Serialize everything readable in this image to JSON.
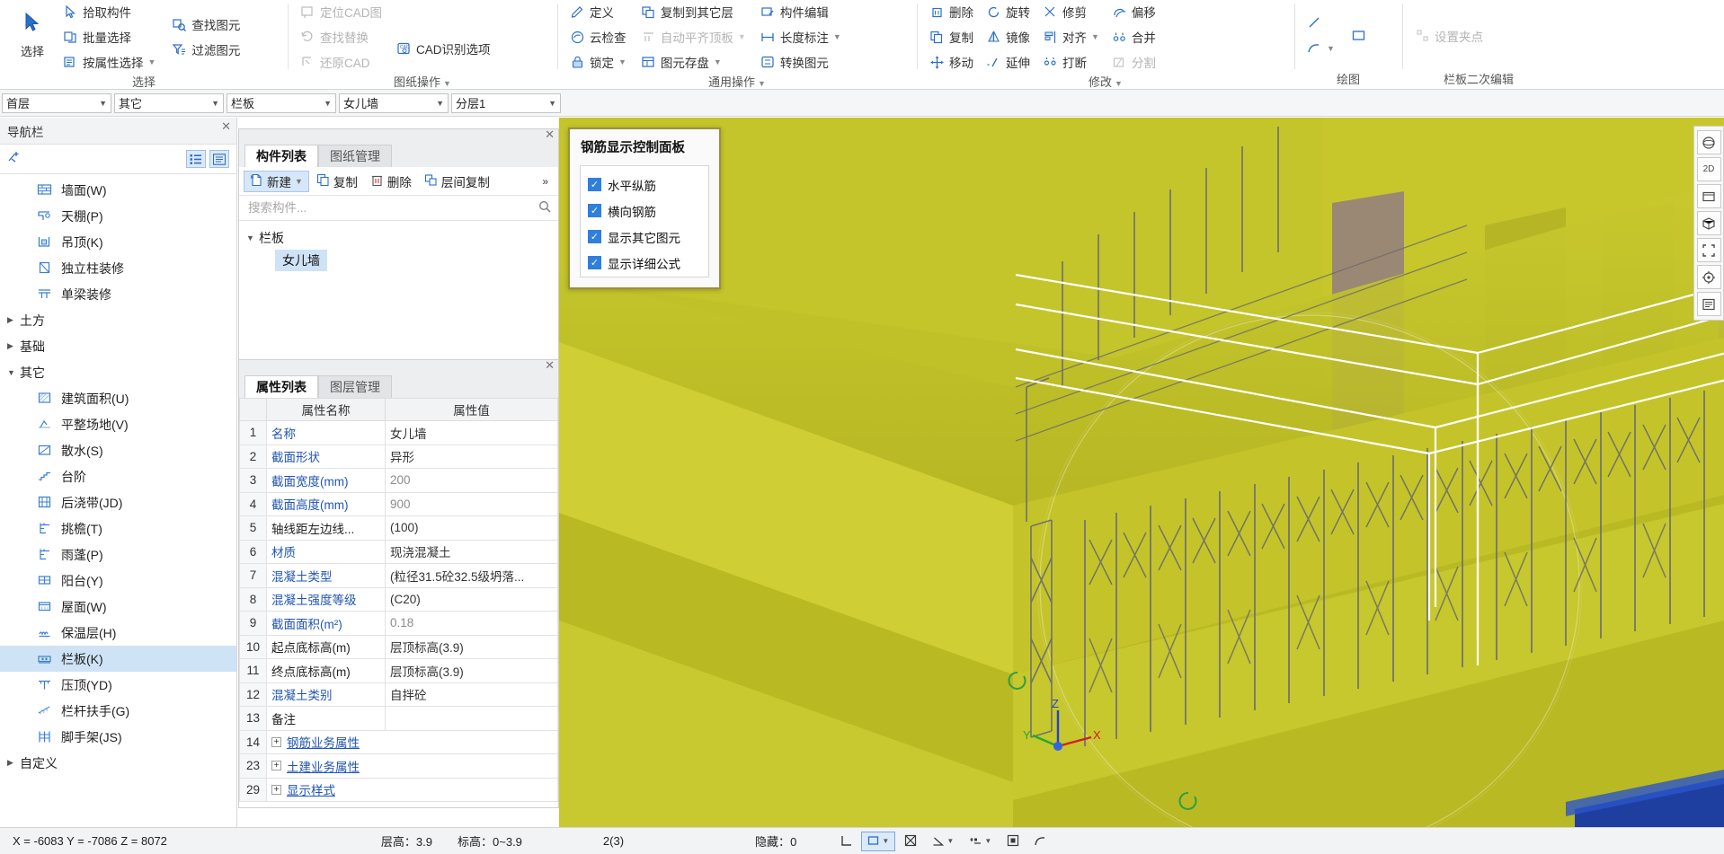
{
  "ribbon": {
    "groups": [
      {
        "title": "选择",
        "big": {
          "label": "选择",
          "icon": "cursor-arrow-icon"
        },
        "items": [
          {
            "label": "拾取构件",
            "icon": "pick-element-icon",
            "caret": false,
            "disabled": false
          },
          {
            "label": "批量选择",
            "icon": "batch-select-icon",
            "caret": false,
            "disabled": false
          },
          {
            "label": "按属性选择",
            "icon": "select-by-property-icon",
            "caret": true,
            "disabled": false
          }
        ],
        "items2": [
          {
            "label": "查找图元",
            "icon": "find-element-icon",
            "caret": false,
            "disabled": false
          },
          {
            "label": "过滤图元",
            "icon": "filter-element-icon",
            "caret": false,
            "disabled": false
          }
        ]
      },
      {
        "title": "图纸操作",
        "caret": true,
        "items": [
          {
            "label": "定位CAD图",
            "icon": "locate-cad-icon",
            "caret": false,
            "disabled": true
          },
          {
            "label": "查找替换",
            "icon": "find-replace-icon",
            "caret": false,
            "disabled": true
          },
          {
            "label": "还原CAD",
            "icon": "restore-cad-icon",
            "caret": false,
            "disabled": true
          }
        ],
        "items2": [
          {
            "label": "CAD识别选项",
            "icon": "cad-recognize-options-icon",
            "caret": false,
            "disabled": false
          }
        ]
      },
      {
        "title": "通用操作",
        "caret": true,
        "items": [
          {
            "label": "定义",
            "icon": "define-icon",
            "caret": false,
            "disabled": false
          },
          {
            "label": "云检查",
            "icon": "cloud-check-icon",
            "caret": false,
            "disabled": false
          },
          {
            "label": "锁定",
            "icon": "lock-icon",
            "caret": true,
            "disabled": false
          }
        ],
        "items2": [
          {
            "label": "复制到其它层",
            "icon": "copy-to-layer-icon",
            "caret": false,
            "disabled": false
          },
          {
            "label": "自动平齐顶板",
            "icon": "auto-align-top-icon",
            "caret": true,
            "disabled": true
          },
          {
            "label": "图元存盘",
            "icon": "element-save-icon",
            "caret": true,
            "disabled": false
          }
        ],
        "items3": [
          {
            "label": "构件编辑",
            "icon": "component-edit-icon",
            "caret": false,
            "disabled": false
          },
          {
            "label": "长度标注",
            "icon": "length-dimension-icon",
            "caret": true,
            "disabled": false
          },
          {
            "label": "转换图元",
            "icon": "convert-element-icon",
            "caret": false,
            "disabled": false
          }
        ]
      },
      {
        "title": "修改",
        "caret": true,
        "items": [
          {
            "label": "删除",
            "icon": "delete-icon",
            "caret": false,
            "disabled": false
          },
          {
            "label": "复制",
            "icon": "copy-icon",
            "caret": false,
            "disabled": false
          },
          {
            "label": "移动",
            "icon": "move-icon",
            "caret": false,
            "disabled": false
          }
        ],
        "items2": [
          {
            "label": "旋转",
            "icon": "rotate-icon",
            "caret": false,
            "disabled": false
          },
          {
            "label": "镜像",
            "icon": "mirror-icon",
            "caret": false,
            "disabled": false
          },
          {
            "label": "延伸",
            "icon": "extend-icon",
            "caret": false,
            "disabled": false
          }
        ],
        "items3": [
          {
            "label": "修剪",
            "icon": "trim-icon",
            "caret": false,
            "disabled": false
          },
          {
            "label": "对齐",
            "icon": "align-icon",
            "caret": true,
            "disabled": false
          },
          {
            "label": "打断",
            "icon": "break-icon",
            "caret": false,
            "disabled": false
          }
        ],
        "items4": [
          {
            "label": "偏移",
            "icon": "offset-icon",
            "caret": false,
            "disabled": false
          },
          {
            "label": "合并",
            "icon": "merge-icon",
            "caret": false,
            "disabled": false
          },
          {
            "label": "分割",
            "icon": "split-icon",
            "caret": false,
            "disabled": true
          }
        ]
      },
      {
        "title": "绘图",
        "items": [
          {
            "label": "直线",
            "icon": "line-icon",
            "caret": false,
            "disabled": false
          },
          {
            "label": "弧线",
            "icon": "arc-icon",
            "caret": true,
            "disabled": false
          }
        ],
        "items2": [
          {
            "label": "矩形",
            "icon": "rectangle-icon",
            "caret": false,
            "disabled": false
          }
        ]
      },
      {
        "title": "栏板二次编辑",
        "items": [
          {
            "label": "设置夹点",
            "icon": "set-grip-icon",
            "caret": false,
            "disabled": true
          }
        ]
      }
    ]
  },
  "selector_bar": {
    "combos": [
      {
        "name": "floor",
        "value": "首层"
      },
      {
        "name": "category",
        "value": "其它"
      },
      {
        "name": "element-type",
        "value": "栏板"
      },
      {
        "name": "component",
        "value": "女儿墙"
      },
      {
        "name": "layer",
        "value": "分层1"
      }
    ]
  },
  "nav": {
    "title": "导航栏",
    "add_icon": "add-node-icon",
    "view_icons": [
      "list-view-icon",
      "detail-view-icon"
    ],
    "tree": [
      {
        "type": "leaf",
        "label": "墙面(W)",
        "icon": "wall-surface-icon",
        "selected": false
      },
      {
        "type": "leaf",
        "label": "天棚(P)",
        "icon": "ceiling-soffit-icon",
        "selected": false
      },
      {
        "type": "leaf",
        "label": "吊顶(K)",
        "icon": "suspended-ceiling-icon",
        "selected": false
      },
      {
        "type": "leaf",
        "label": "独立柱装修",
        "icon": "column-finish-icon",
        "selected": false
      },
      {
        "type": "leaf",
        "label": "单梁装修",
        "icon": "beam-finish-icon",
        "selected": false
      },
      {
        "type": "group",
        "label": "土方",
        "expanded": false
      },
      {
        "type": "group",
        "label": "基础",
        "expanded": false
      },
      {
        "type": "group",
        "label": "其它",
        "expanded": true
      },
      {
        "type": "leaf",
        "label": "建筑面积(U)",
        "icon": "building-area-icon",
        "selected": false
      },
      {
        "type": "leaf",
        "label": "平整场地(V)",
        "icon": "site-leveling-icon",
        "selected": false
      },
      {
        "type": "leaf",
        "label": "散水(S)",
        "icon": "apron-icon",
        "selected": false
      },
      {
        "type": "leaf",
        "label": "台阶",
        "icon": "steps-icon",
        "selected": false
      },
      {
        "type": "leaf",
        "label": "后浇带(JD)",
        "icon": "post-cast-strip-icon",
        "selected": false
      },
      {
        "type": "leaf",
        "label": "挑檐(T)",
        "icon": "overhanging-eave-icon",
        "selected": false
      },
      {
        "type": "leaf",
        "label": "雨蓬(P)",
        "icon": "canopy-icon",
        "selected": false
      },
      {
        "type": "leaf",
        "label": "阳台(Y)",
        "icon": "balcony-icon",
        "selected": false
      },
      {
        "type": "leaf",
        "label": "屋面(W)",
        "icon": "roof-icon",
        "selected": false
      },
      {
        "type": "leaf",
        "label": "保温层(H)",
        "icon": "insulation-layer-icon",
        "selected": false
      },
      {
        "type": "leaf",
        "label": "栏板(K)",
        "icon": "railing-panel-icon",
        "selected": true
      },
      {
        "type": "leaf",
        "label": "压顶(YD)",
        "icon": "coping-icon",
        "selected": false
      },
      {
        "type": "leaf",
        "label": "栏杆扶手(G)",
        "icon": "handrail-icon",
        "selected": false
      },
      {
        "type": "leaf",
        "label": "脚手架(JS)",
        "icon": "scaffolding-icon",
        "selected": false
      },
      {
        "type": "group",
        "label": "自定义",
        "expanded": false
      }
    ]
  },
  "component_panel": {
    "tabs": [
      {
        "label": "构件列表",
        "active": true
      },
      {
        "label": "图纸管理",
        "active": false
      }
    ],
    "toolbar": [
      {
        "label": "新建",
        "icon": "new-icon",
        "caret": true,
        "highlight": true
      },
      {
        "label": "复制",
        "icon": "copy-icon",
        "caret": false,
        "highlight": false
      },
      {
        "label": "删除",
        "icon": "trash-icon",
        "caret": false,
        "highlight": false
      },
      {
        "label": "层间复制",
        "icon": "copy-between-floors-icon",
        "caret": false,
        "highlight": false
      }
    ],
    "overflow_icon": "chevron-double-right-icon",
    "search_placeholder": "搜索构件...",
    "search_value": "",
    "search_icon": "search-icon",
    "tree_group": "栏板",
    "tree_item": "女儿墙"
  },
  "property_panel": {
    "tabs": [
      {
        "label": "属性列表",
        "active": true
      },
      {
        "label": "图层管理",
        "active": false
      }
    ],
    "columns": [
      "",
      "属性名称",
      "属性值"
    ],
    "rows": [
      {
        "idx": "1",
        "name": "名称",
        "value": "女儿墙",
        "blue": true,
        "gray": false,
        "expandable": false
      },
      {
        "idx": "2",
        "name": "截面形状",
        "value": "异形",
        "blue": true,
        "gray": false,
        "expandable": false
      },
      {
        "idx": "3",
        "name": "截面宽度(mm)",
        "value": "200",
        "blue": true,
        "gray": true,
        "expandable": false
      },
      {
        "idx": "4",
        "name": "截面高度(mm)",
        "value": "900",
        "blue": true,
        "gray": true,
        "expandable": false
      },
      {
        "idx": "5",
        "name": "轴线距左边线...",
        "value": "(100)",
        "blue": false,
        "gray": false,
        "expandable": false
      },
      {
        "idx": "6",
        "name": "材质",
        "value": "现浇混凝土",
        "blue": true,
        "gray": false,
        "expandable": false
      },
      {
        "idx": "7",
        "name": "混凝土类型",
        "value": "(粒径31.5砼32.5级坍落...",
        "blue": true,
        "gray": false,
        "expandable": false
      },
      {
        "idx": "8",
        "name": "混凝土强度等级",
        "value": "(C20)",
        "blue": true,
        "gray": false,
        "expandable": false
      },
      {
        "idx": "9",
        "name": "截面面积(m²)",
        "value": "0.18",
        "blue": true,
        "gray": true,
        "expandable": false
      },
      {
        "idx": "10",
        "name": "起点底标高(m)",
        "value": "层顶标高(3.9)",
        "blue": false,
        "gray": false,
        "expandable": false
      },
      {
        "idx": "11",
        "name": "终点底标高(m)",
        "value": "层顶标高(3.9)",
        "blue": false,
        "gray": false,
        "expandable": false
      },
      {
        "idx": "12",
        "name": "混凝土类别",
        "value": "自拌砼",
        "blue": true,
        "gray": false,
        "expandable": false
      },
      {
        "idx": "13",
        "name": "备注",
        "value": "",
        "blue": false,
        "gray": false,
        "expandable": false
      },
      {
        "idx": "14",
        "name": "钢筋业务属性",
        "value": "",
        "blue": false,
        "gray": false,
        "expandable": true
      },
      {
        "idx": "23",
        "name": "土建业务属性",
        "value": "",
        "blue": false,
        "gray": false,
        "expandable": true
      },
      {
        "idx": "29",
        "name": "显示样式",
        "value": "",
        "blue": false,
        "gray": false,
        "expandable": true
      }
    ]
  },
  "dialog": {
    "title": "钢筋显示控制面板",
    "checkboxes": [
      {
        "label": "水平纵筋",
        "checked": true
      },
      {
        "label": "横向钢筋",
        "checked": true
      },
      {
        "label": "显示其它图元",
        "checked": true
      },
      {
        "label": "显示详细公式",
        "checked": true
      }
    ],
    "check_glyph": "✓"
  },
  "right_dock": {
    "buttons": [
      {
        "name": "orbit-3d-icon",
        "glyph": "◍"
      },
      {
        "name": "view-2d-icon",
        "glyph": "2D"
      },
      {
        "name": "view-front-icon",
        "glyph": "▭"
      },
      {
        "name": "view-iso-icon",
        "glyph": "◰"
      },
      {
        "name": "fit-zoom-icon",
        "glyph": "⛶"
      },
      {
        "name": "target-center-icon",
        "glyph": "◎"
      },
      {
        "name": "layers-panel-icon",
        "glyph": "▤"
      }
    ]
  },
  "viewport": {
    "axis_labels": {
      "x": "X",
      "y": "Y",
      "z": "Z"
    },
    "colors": {
      "slab_top": "#bfbf2a",
      "slab_face": "#cccc33",
      "wall_purple": "#8a7090",
      "rebar_gray": "#767676",
      "outline_white": "#ffffff",
      "accent_blue": "#1e3fa0"
    }
  },
  "status_bar": {
    "coords": "X = -6083 Y = -7086 Z = 8072",
    "floor_height_label": "层高：",
    "floor_height_value": "3.9",
    "elevation_label": "标高：",
    "elevation_value": "0~3.9",
    "count": "2(3)",
    "hidden_label": "隐藏：",
    "hidden_value": "0",
    "tools": [
      {
        "name": "ortho-snap-icon",
        "glyph": "⌐",
        "active": false
      },
      {
        "name": "rect-snap-icon",
        "glyph": "▢",
        "active": true,
        "caret": true
      },
      {
        "name": "intersection-snap-icon",
        "glyph": "✕",
        "active": false
      },
      {
        "name": "angle-snap-icon",
        "glyph": "∠",
        "active": false,
        "caret": true
      },
      {
        "name": "midpoint-snap-icon",
        "glyph": "⊹",
        "active": false,
        "caret": true
      },
      {
        "name": "grid-snap-icon",
        "glyph": "▣",
        "active": false
      },
      {
        "name": "arc-snap-icon",
        "glyph": "◜",
        "active": false
      }
    ]
  }
}
